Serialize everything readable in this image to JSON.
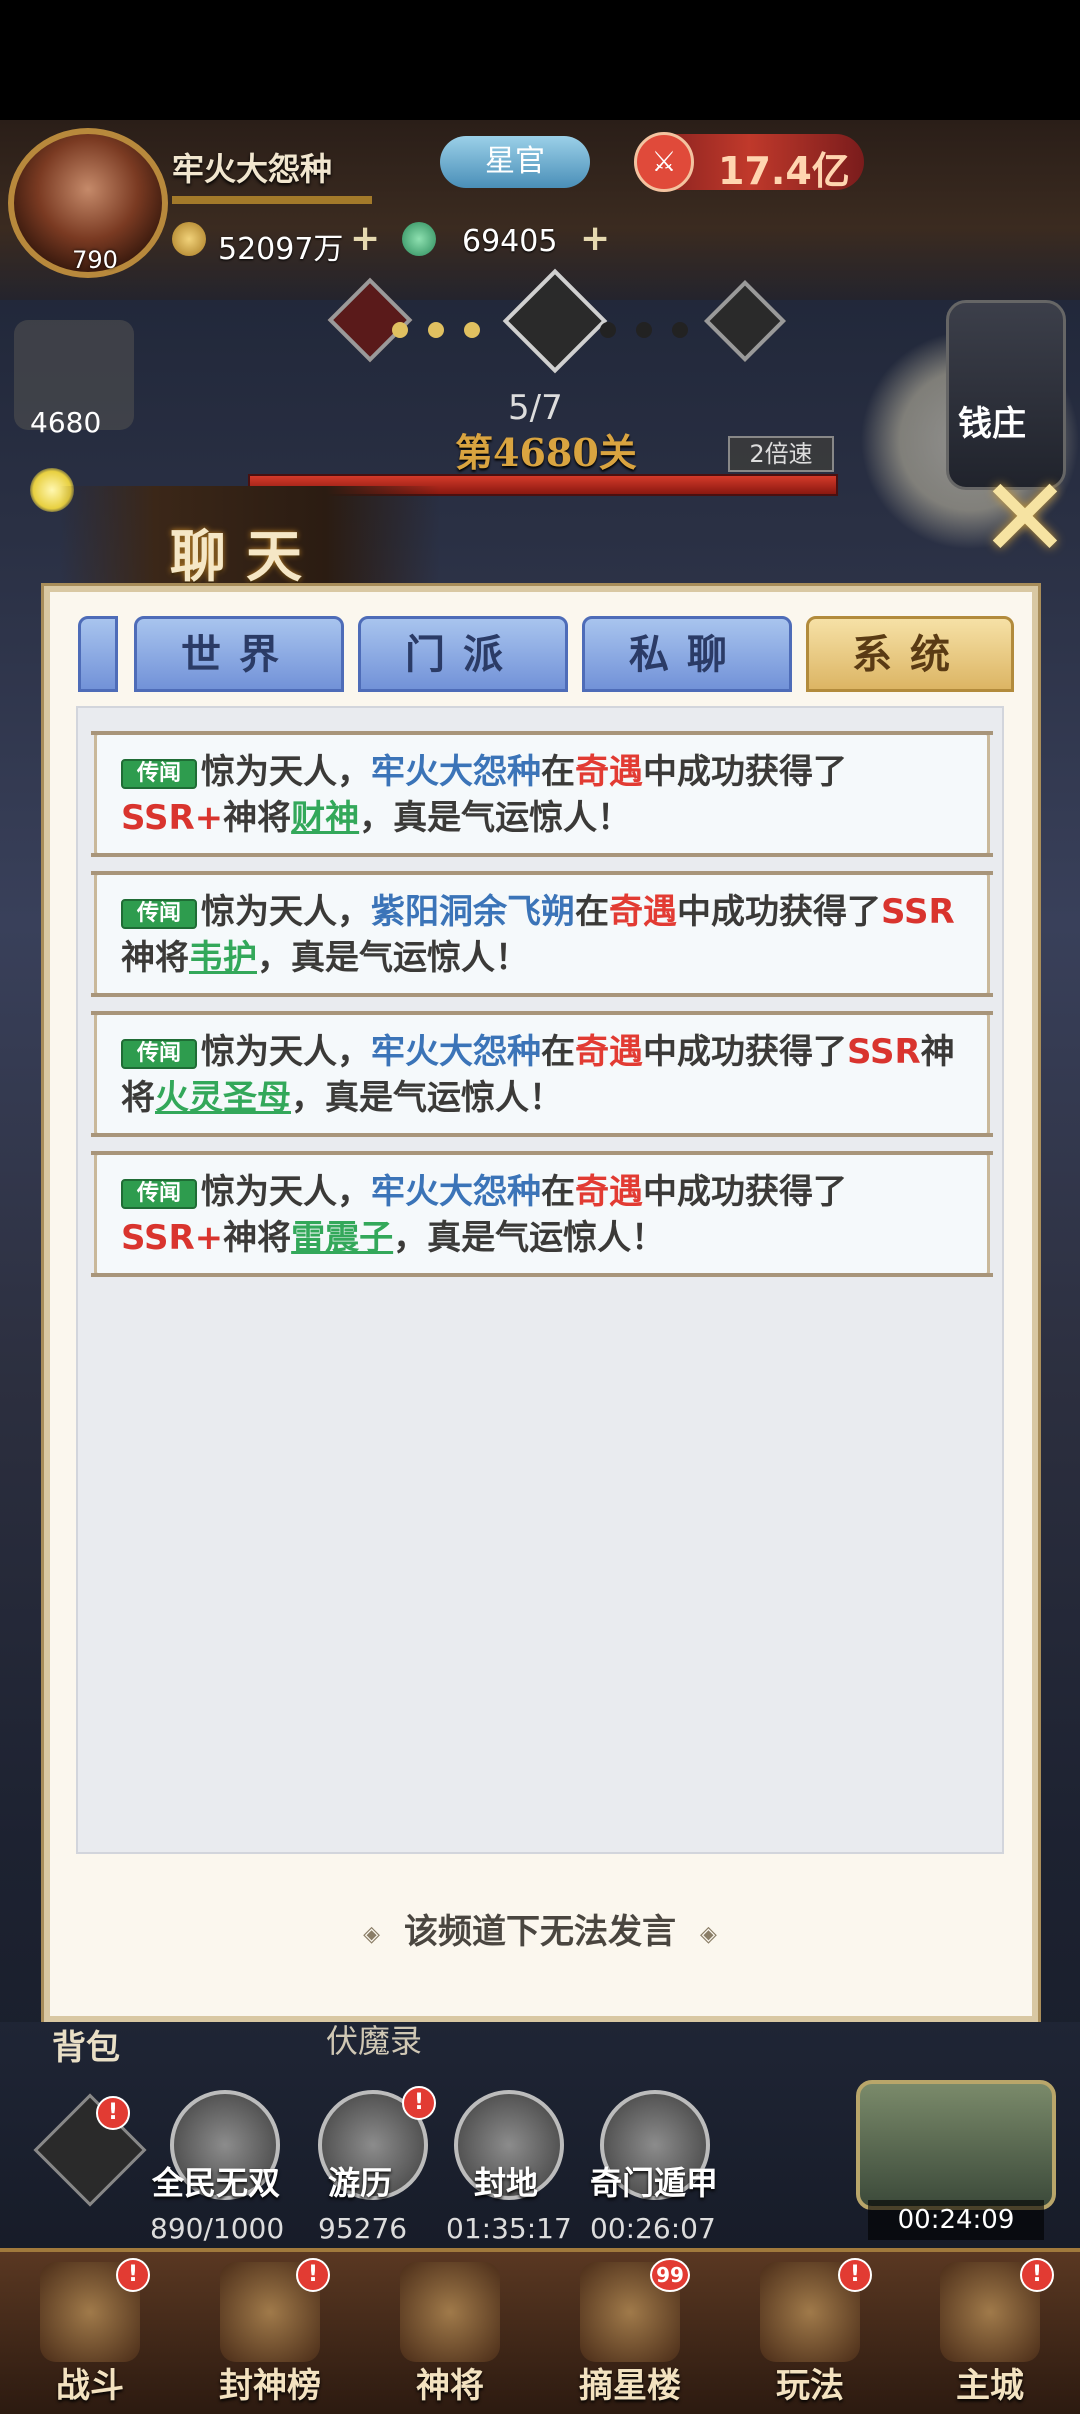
{
  "player": {
    "name": "牢火大怨种",
    "level": "790",
    "title_badge": "星官",
    "power": "17.4亿",
    "gold": "52097万",
    "jade": "69405"
  },
  "stage": {
    "progress": "5/7",
    "title": "第4680关",
    "speed": "2倍速"
  },
  "side": {
    "left_counter": "4680",
    "bank_label": "钱庄"
  },
  "chat": {
    "title": "聊天",
    "tabs": [
      {
        "label": "世界",
        "active": false
      },
      {
        "label": "门派",
        "active": false
      },
      {
        "label": "私聊",
        "active": false
      },
      {
        "label": "系统",
        "active": true
      }
    ],
    "messages": [
      {
        "tag": "传闻",
        "prefix": "惊为天人，",
        "player": "牢火大怨种",
        "at": "在",
        "event": "奇遇",
        "mid": "中成功获得了",
        "rarity": "SSR+",
        "gen": "神将",
        "hero": "财神",
        "suffix": "，真是气运惊人！"
      },
      {
        "tag": "传闻",
        "prefix": "惊为天人，",
        "player": "紫阳洞余飞朔",
        "at": "在",
        "event": "奇遇",
        "mid": "中成功获得了",
        "rarity": "SSR",
        "gen": "神将",
        "hero": "韦护",
        "suffix": "，真是气运惊人！"
      },
      {
        "tag": "传闻",
        "prefix": "惊为天人，",
        "player": "牢火大怨种",
        "at": "在",
        "event": "奇遇",
        "mid": "中成功获得了",
        "rarity": "SSR",
        "gen": "神将",
        "hero": "火灵圣母",
        "suffix": "，真是气运惊人！"
      },
      {
        "tag": "传闻",
        "prefix": "惊为天人，",
        "player": "牢火大怨种",
        "at": "在",
        "event": "奇遇",
        "mid": "中成功获得了",
        "rarity": "SSR+",
        "gen": "神将",
        "hero": "雷震子",
        "suffix": "，真是气运惊人！"
      }
    ],
    "footer_note": "该频道下无法发言"
  },
  "bottom": {
    "bag_label": "背包",
    "fumo_label": "伏魔录",
    "features": [
      {
        "label": "全民无双",
        "value": "890/1000"
      },
      {
        "label": "游历",
        "value": "95276"
      },
      {
        "label": "封地",
        "value": "01:35:17"
      },
      {
        "label": "奇门遁甲",
        "value": "00:26:07"
      }
    ],
    "chest_timer": "00:24:09"
  },
  "nav": [
    {
      "label": "战斗",
      "badge": "!"
    },
    {
      "label": "封神榜",
      "badge": "!"
    },
    {
      "label": "神将",
      "badge": ""
    },
    {
      "label": "摘星楼",
      "badge": "99"
    },
    {
      "label": "玩法",
      "badge": "!"
    },
    {
      "label": "主城",
      "badge": "!"
    }
  ],
  "colors": {
    "tab_active": "#dcb564",
    "tab_inactive": "#7292d8",
    "player_name": "#3b74b8",
    "event_red": "#e23b33",
    "hero_green": "#33a85a",
    "tag_green": "#2e9c4e"
  }
}
